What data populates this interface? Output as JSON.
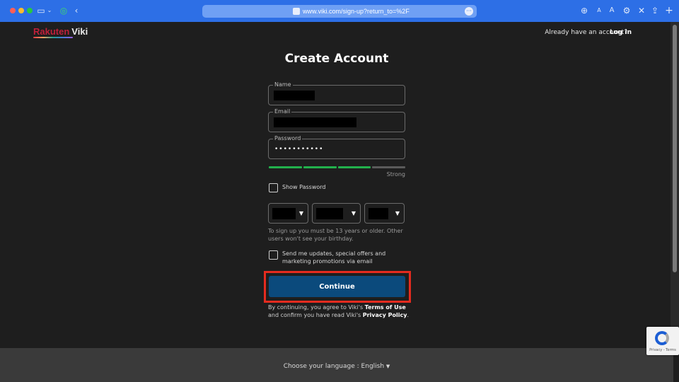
{
  "browser": {
    "url": "www.viki.com/sign-up?return_to=%2F",
    "accent_color": "#2d6fe6"
  },
  "header": {
    "logo_part1": "Rakuten",
    "logo_part2": "Viki",
    "already_text": "Already have an account?",
    "login_label": "Log in"
  },
  "form": {
    "title": "Create Account",
    "name_label": "Name",
    "email_label": "Email",
    "password_label": "Password",
    "password_value": "•••••••••••",
    "strength_label": "Strong",
    "strength_level": 3,
    "strength_segments": 4,
    "show_password_label": "Show Password",
    "birthday_hint": "To sign up you must be 13 years or older. Other users won't see your birthday.",
    "updates_label": "Send me updates, special offers and marketing promotions via email",
    "continue_label": "Continue",
    "terms_prefix": "By continuing, you agree to Viki's",
    "terms_link": "Terms of Use",
    "terms_middle": "and confirm you have read Viki's",
    "privacy_link": "Privacy Policy",
    "terms_suffix": "."
  },
  "footer": {
    "language_prefix": "Choose your language :",
    "language_value": "English"
  },
  "recaptcha": {
    "text": "Privacy - Terms"
  },
  "colors": {
    "continue_button": "#0b4a7c",
    "highlight_box": "#e42b1f",
    "strength_bar": "#22b14c"
  }
}
